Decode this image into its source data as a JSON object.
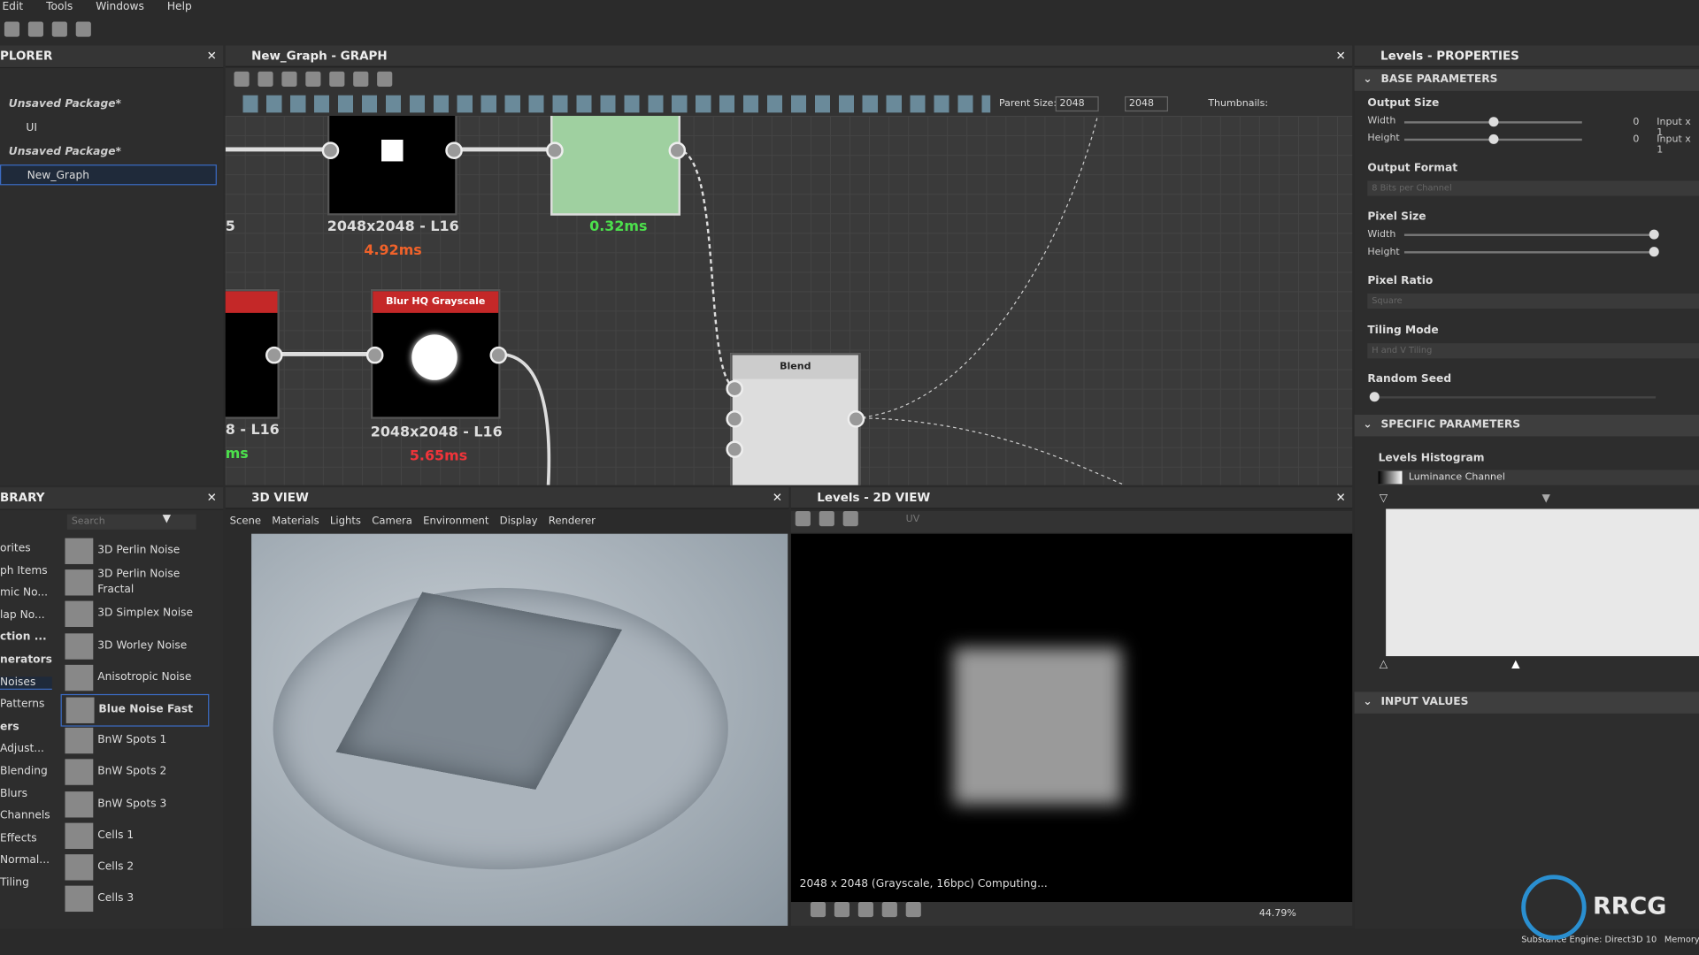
{
  "menu": [
    "Edit",
    "Tools",
    "Windows",
    "Help"
  ],
  "explorer": {
    "title": "PLORER",
    "items": [
      {
        "label": "Unsaved Package*"
      },
      {
        "label": "UI"
      },
      {
        "label": "Unsaved Package*"
      },
      {
        "label": "New_Graph"
      }
    ]
  },
  "graph": {
    "title": "New_Graph - GRAPH",
    "parent_size_label": "Parent Size:",
    "parent_size": "2048",
    "size2": "2048",
    "thumbnails_label": "Thumbnails:",
    "nodes": [
      {
        "size": "2048x2048 - L16",
        "time": "4.92ms"
      },
      {
        "time": "0.32ms"
      },
      {
        "title": "Blur HQ Grayscale",
        "size": "2048x2048 - L16",
        "time": "5.65ms"
      },
      {
        "title": "Blend"
      },
      {
        "size": "8 - L16",
        "time": "ms"
      },
      {
        "size": "5"
      }
    ]
  },
  "properties": {
    "title": "Levels - PROPERTIES",
    "base_section": "BASE PARAMETERS",
    "output_size": "Output Size",
    "width": "Width",
    "height": "Height",
    "zero": "0",
    "input": "Input x 1",
    "output_format": "Output Format",
    "output_format_value": "8 Bits per Channel",
    "pixel_size": "Pixel Size",
    "pixel_ratio": "Pixel Ratio",
    "pixel_ratio_value": "Square",
    "tiling_mode": "Tiling Mode",
    "tiling_mode_value": "H and V Tiling",
    "random_seed": "Random Seed",
    "specific_section": "SPECIFIC PARAMETERS",
    "levels_histogram": "Levels Histogram",
    "channel": "Luminance Channel",
    "input_values": "INPUT VALUES"
  },
  "library": {
    "title": "BRARY",
    "search_placeholder": "Search",
    "categories": [
      "orites",
      "ph Items",
      "mic No...",
      "lap No...",
      "ction ...",
      "nerators",
      "Noises",
      "Patterns",
      "ers",
      "Adjust...",
      "Blending",
      "Blurs",
      "Channels",
      "Effects",
      "Normal...",
      "Tiling"
    ],
    "items": [
      "3D Perlin Noise",
      "3D Perlin Noise Fractal",
      "3D Simplex Noise",
      "3D Worley Noise",
      "Anisotropic Noise",
      "Blue Noise Fast",
      "BnW Spots 1",
      "BnW Spots 2",
      "BnW Spots 3",
      "Cells 1",
      "Cells 2",
      "Cells 3"
    ]
  },
  "view3d": {
    "title": "3D VIEW",
    "menu": [
      "Scene",
      "Materials",
      "Lights",
      "Camera",
      "Environment",
      "Display",
      "Renderer"
    ]
  },
  "view2d": {
    "title": "Levels - 2D VIEW",
    "uv": "UV",
    "status": "2048 x 2048 (Grayscale, 16bpc) Computing...",
    "zoom": "44.79%"
  },
  "statusbar": {
    "engine": "Substance Engine: Direct3D 10",
    "memory": "Memory"
  },
  "watermark": "RRCG 人人素材"
}
